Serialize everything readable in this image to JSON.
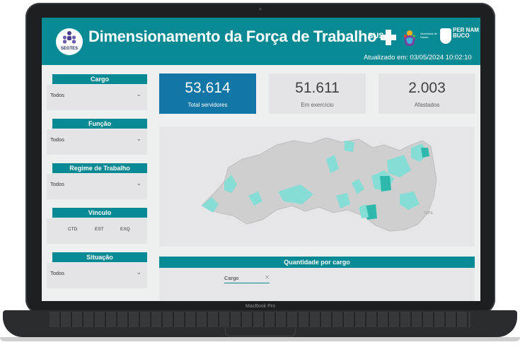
{
  "header": {
    "logo_text": "SEGTES",
    "title": "Dimensionamento da Força de Trabalho",
    "sus_label": "SUS",
    "secretaria_label": "Secretaria de Saúde",
    "state_label": "PER NAM BUCO",
    "updated": "Atualizado em: 03/05/2024 10:02:10"
  },
  "filters": [
    {
      "label": "Cargo",
      "value": "Todos"
    },
    {
      "label": "Função",
      "value": "Todos"
    },
    {
      "label": "Regime de Trabalho",
      "value": "Todos"
    },
    {
      "label": "Vínculo",
      "options": [
        "CTD",
        "EST",
        "EXQ"
      ]
    },
    {
      "label": "Situação",
      "value": "Todos"
    }
  ],
  "kpis": [
    {
      "value": "53.614",
      "label": "Total servidores"
    },
    {
      "value": "51.611",
      "label": "Em exercício"
    },
    {
      "value": "2.003",
      "label": "Afastados"
    }
  ],
  "map": {
    "label": "TEPE"
  },
  "quantity_panel": {
    "title": "Quantidade por cargo",
    "chip_label": "Cargo",
    "chip_clear": "✕"
  },
  "device": {
    "brand": "MacBook Pro"
  },
  "colors": {
    "header": "#088a94",
    "kpi_highlight": "#1276a6",
    "map_teal": "#3fd1c6"
  }
}
